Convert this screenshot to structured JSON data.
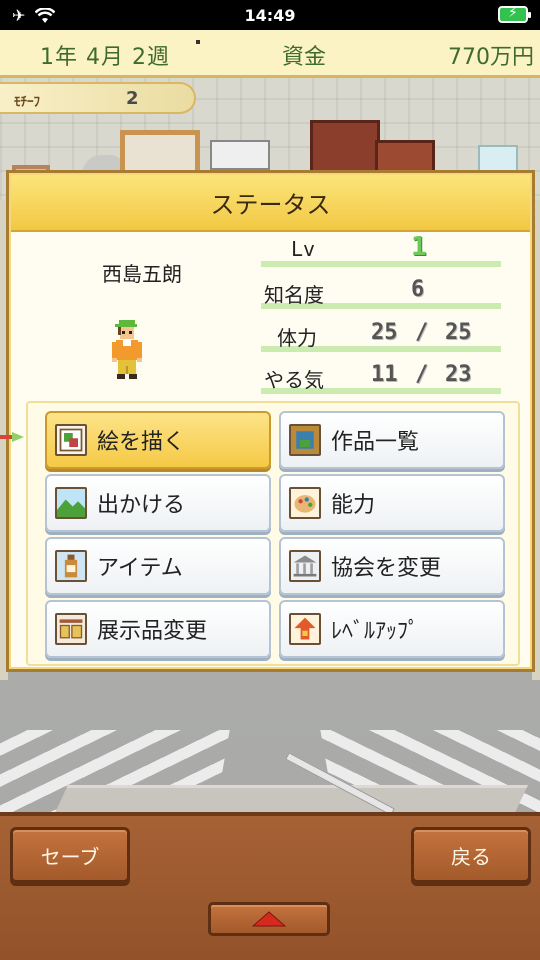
{
  "status_bar": {
    "time": "14:49"
  },
  "hud": {
    "date": "1年  4月  2週",
    "money_label": "資金",
    "money": "770万円"
  },
  "motif": {
    "label": "ﾓﾁｰﾌ",
    "value": "2"
  },
  "panel": {
    "title": "ステータス",
    "character_name": "西島五朗",
    "stats": {
      "lv_label": "Lv",
      "lv": "1",
      "fame_label": "知名度",
      "fame": "6",
      "stamina_label": "体力",
      "stamina_current": "25",
      "stamina_sep": "/",
      "stamina_max": "25",
      "motivation_label": "やる気",
      "motivation_current": "11",
      "motivation_sep": "/",
      "motivation_max": "23"
    },
    "menu": [
      {
        "label": "絵を描く",
        "icon": "painting-canvas-icon"
      },
      {
        "label": "作品一覧",
        "icon": "framed-picture-icon"
      },
      {
        "label": "出かける",
        "icon": "landscape-icon"
      },
      {
        "label": "能力",
        "icon": "palette-icon"
      },
      {
        "label": "アイテム",
        "icon": "bottle-icon"
      },
      {
        "label": "協会を変更",
        "icon": "museum-building-icon"
      },
      {
        "label": "展示品変更",
        "icon": "exhibit-frames-icon"
      },
      {
        "label": "ﾚﾍﾞﾙｱｯﾌﾟ",
        "icon": "level-up-arrow-icon"
      }
    ]
  },
  "bottom": {
    "save_label": "セーブ",
    "back_label": "戻る"
  },
  "colors": {
    "hud_text": "#3f6b2c",
    "panel_header": "#f2c843",
    "active_button": "#f5c945",
    "stat_bar": "#ccebb1",
    "wood": "#a45a2c"
  }
}
